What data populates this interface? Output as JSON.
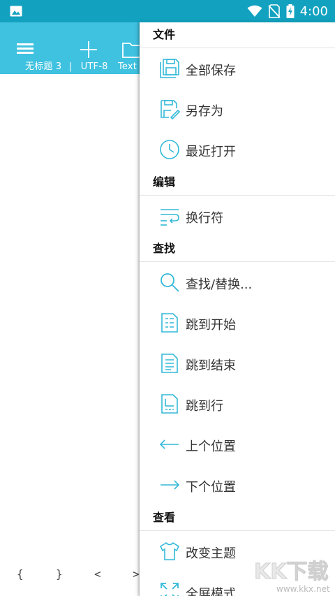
{
  "status_bar": {
    "time": "4:00"
  },
  "app_bar": {
    "filename": "无标题 3",
    "separator": "|",
    "encoding": "UTF-8",
    "mode": "Text"
  },
  "symbols": [
    "{",
    "}",
    "<",
    ">"
  ],
  "drawer": {
    "sections": [
      {
        "title": "文件",
        "items": [
          {
            "label": "全部保存",
            "icon": "save-all-icon"
          },
          {
            "label": "另存为",
            "icon": "save-as-icon"
          },
          {
            "label": "最近打开",
            "icon": "clock-icon"
          }
        ]
      },
      {
        "title": "编辑",
        "items": [
          {
            "label": "换行符",
            "icon": "line-break-icon"
          }
        ]
      },
      {
        "title": "查找",
        "items": [
          {
            "label": "查找/替换...",
            "icon": "search-icon"
          },
          {
            "label": "跳到开始",
            "icon": "document-top-icon"
          },
          {
            "label": "跳到结束",
            "icon": "document-bottom-icon"
          },
          {
            "label": "跳到行",
            "icon": "document-line-icon"
          },
          {
            "label": "上个位置",
            "icon": "arrow-left-icon"
          },
          {
            "label": "下个位置",
            "icon": "arrow-right-icon"
          }
        ]
      },
      {
        "title": "查看",
        "items": [
          {
            "label": "改变主题",
            "icon": "shirt-icon"
          },
          {
            "label": "全屏模式",
            "icon": "fullscreen-icon"
          }
        ]
      }
    ]
  },
  "watermark": {
    "text": "KK下载",
    "url": "www.kkx.net"
  },
  "colors": {
    "status_bar": "#12a2c0",
    "app_bar": "#3fc1e0",
    "accent": "#33b9d9"
  }
}
